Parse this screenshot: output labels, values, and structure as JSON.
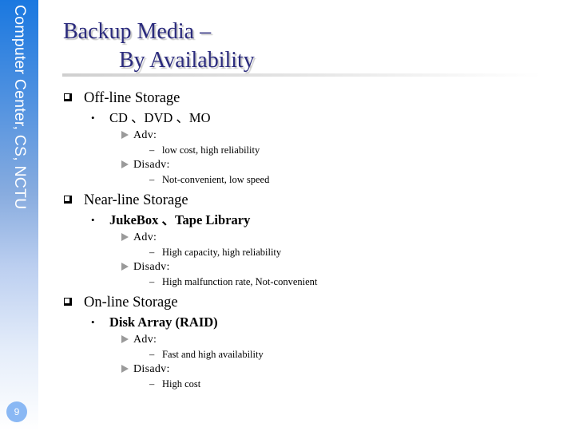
{
  "sidebar": {
    "label": "Computer Center, CS, NCTU",
    "page_number": "9"
  },
  "title": {
    "line1": "Backup Media –",
    "line2": "By Availability"
  },
  "sections": [
    {
      "heading": "Off-line Storage",
      "item": "CD 、DVD 、MO",
      "adv_label": "Adv:",
      "adv": "low cost, high reliability",
      "disadv_label": "Disadv:",
      "disadv": "Not-convenient, low speed"
    },
    {
      "heading": "Near-line Storage",
      "item": "JukeBox 、Tape Library",
      "adv_label": "Adv:",
      "adv": "High capacity, high reliability",
      "disadv_label": "Disadv:",
      "disadv": "High malfunction rate, Not-convenient"
    },
    {
      "heading": "On-line Storage",
      "item": "Disk Array (RAID)",
      "adv_label": "Adv:",
      "adv": "Fast and high availability",
      "disadv_label": "Disadv:",
      "disadv": "High cost"
    }
  ],
  "bullets": {
    "level2": "•",
    "level4": "–"
  },
  "colors": {
    "title": "#2b2b7d",
    "sidebar_top": "#1a78e0",
    "sidebar_bottom": "#ffffff",
    "badge": "#8ab8f4"
  }
}
